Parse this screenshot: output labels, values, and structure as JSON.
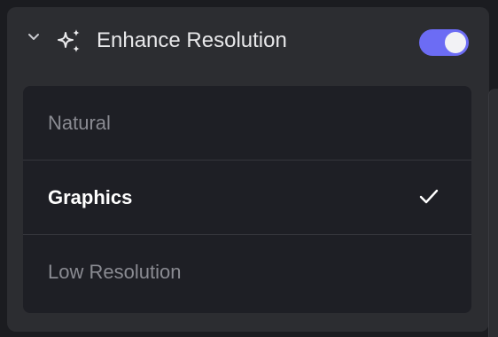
{
  "section": {
    "title": "Enhance Resolution",
    "enabled": true
  },
  "options": [
    {
      "label": "Natural",
      "selected": false
    },
    {
      "label": "Graphics",
      "selected": true
    },
    {
      "label": "Low Resolution",
      "selected": false
    }
  ],
  "colors": {
    "toggle_on": "#6c6cf4",
    "panel": "#2c2d31",
    "list_bg": "#1e1f25"
  },
  "icons": {
    "collapse": "chevron-down-icon",
    "feature": "sparkle-icon",
    "selected": "checkmark-icon"
  }
}
